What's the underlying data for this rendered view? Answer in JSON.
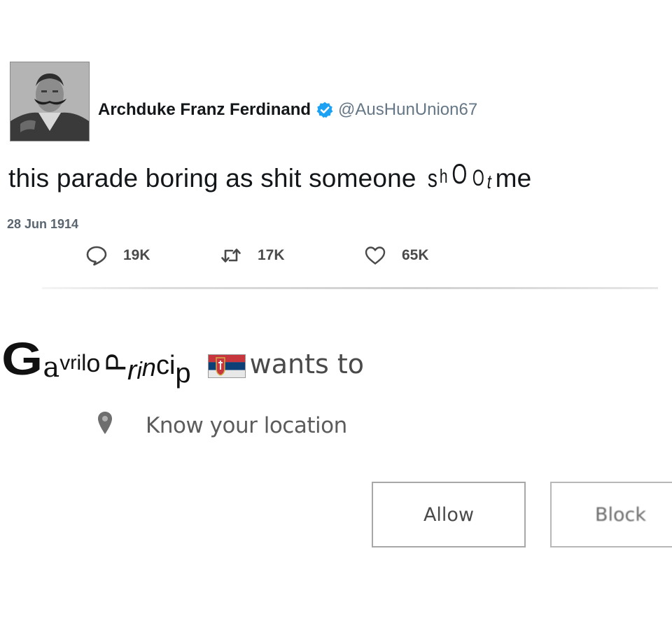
{
  "tweet": {
    "author_name": "Archduke Franz Ferdinand",
    "verified_icon": "verified-badge-icon",
    "handle": "@AusHunUnion67",
    "text_before": "this parade boring as shit someone ",
    "shoot_letters": [
      "s",
      "h",
      "O",
      "O",
      "t"
    ],
    "text_after": "me",
    "date": "28 Jun 1914",
    "stats": {
      "replies": "19K",
      "retweets": "17K",
      "likes": "65K"
    },
    "colors": {
      "verified": "#1da1f2",
      "handle": "#657786"
    }
  },
  "permission_prompt": {
    "sender_letters": [
      "G",
      "a",
      "v",
      "r",
      "i",
      "l",
      "o",
      "P",
      "r",
      "i",
      "n",
      "c",
      "i",
      "p"
    ],
    "flag_icon": "serbian-flag-icon",
    "wants_text": "wants to",
    "permission_icon": "location-pin-icon",
    "permission_text": "Know your location",
    "allow_label": "Allow",
    "block_label": "Block"
  }
}
